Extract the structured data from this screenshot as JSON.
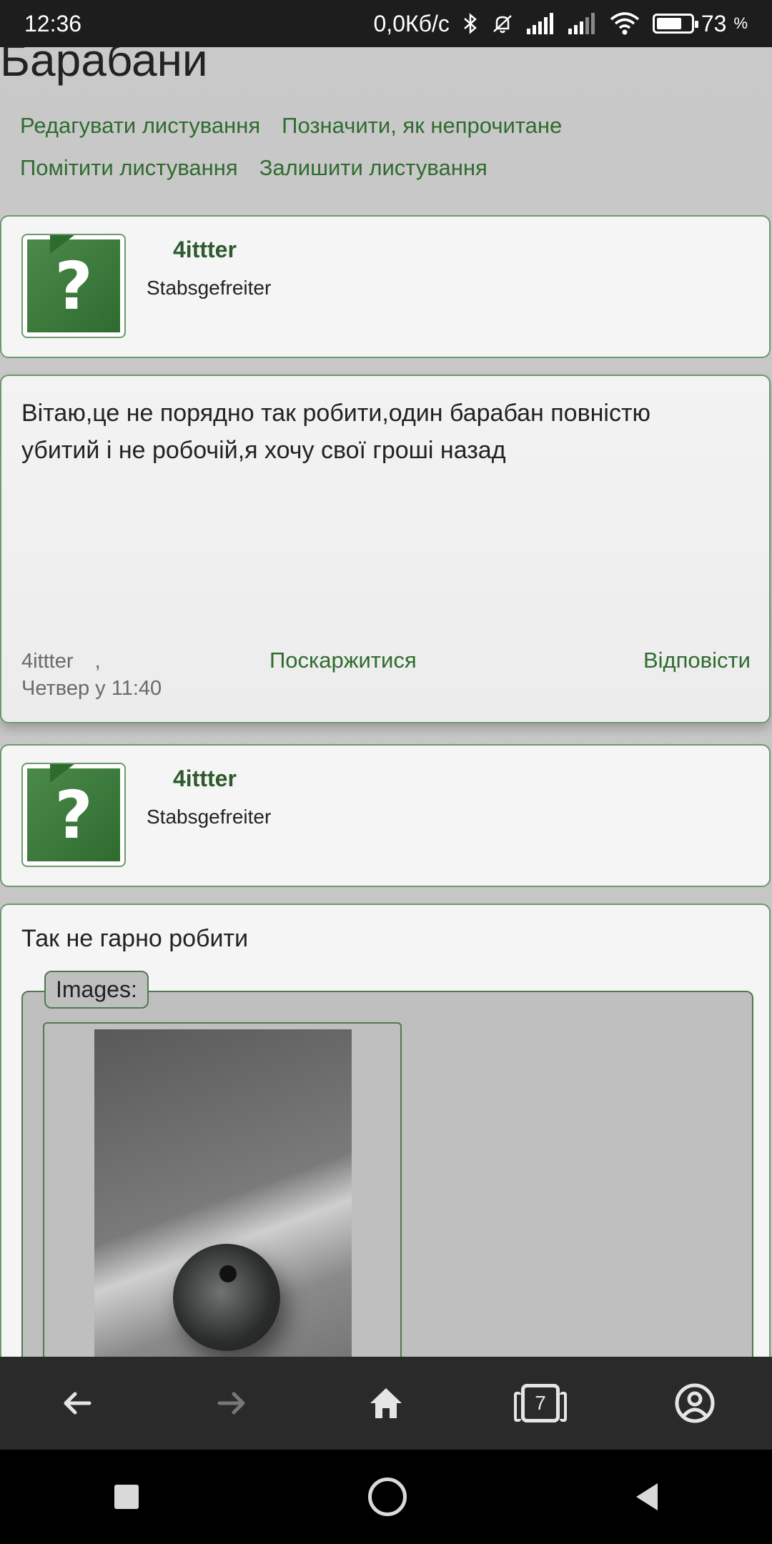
{
  "status_bar": {
    "time": "12:36",
    "network_speed": "0,0Кб/с",
    "battery_percent": "73",
    "battery_unit": "%",
    "icons": [
      "bluetooth-icon",
      "mute-icon",
      "signal-icon",
      "signal-icon",
      "wifi-icon",
      "battery-icon"
    ]
  },
  "page": {
    "title": "Барабани"
  },
  "thread_actions": {
    "edit": "Редагувати листування",
    "mark_unread": "Позначити, як непрочитане",
    "flag": "Помітити листування",
    "leave": "Залишити листування"
  },
  "posts": [
    {
      "username": "4ittter",
      "rank": "Stabsgefreiter",
      "text": "Вітаю,це не порядно так робити,один барабан повністю убитий і не робочій,я хочу свої гроші назад",
      "meta_user": "4ittter",
      "meta_sep": ",",
      "meta_time": "Четвер у 11:40",
      "report_label": "Поскаржитися",
      "reply_label": "Відповісти"
    },
    {
      "username": "4ittter",
      "rank": "Stabsgefreiter",
      "text": "Так не гарно робити",
      "images_legend": "Images:"
    }
  ],
  "browser_bar": {
    "tab_count": "7",
    "icons": [
      "back-icon",
      "forward-icon",
      "home-icon",
      "tabs-icon",
      "account-icon"
    ]
  },
  "colors": {
    "accent_green": "#2f6b2f",
    "status_bar_bg": "#1d1d1d",
    "browser_bar_bg": "#2a2a2a"
  }
}
